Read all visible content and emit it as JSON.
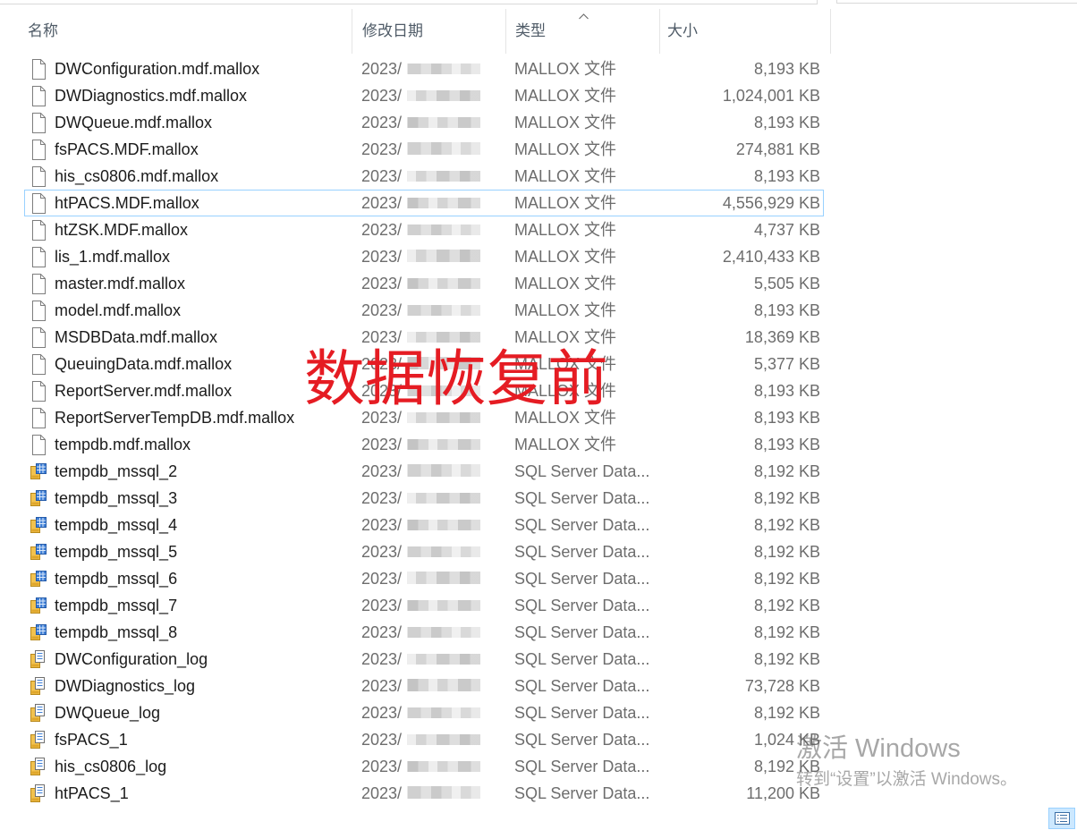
{
  "explorer": {
    "columns": {
      "name": {
        "label": "名称"
      },
      "date": {
        "label": "修改日期"
      },
      "type": {
        "label": "类型",
        "sort_icon": "chevron-up-icon"
      },
      "size": {
        "label": "大小"
      }
    },
    "view_button_icon": "details-view-icon"
  },
  "files": [
    {
      "name": "DWConfiguration.mdf.mallox",
      "date": "2023/",
      "type": "MALLOX 文件",
      "size": "8,193 KB",
      "icon": "blank-document-icon"
    },
    {
      "name": "DWDiagnostics.mdf.mallox",
      "date": "2023/",
      "type": "MALLOX 文件",
      "size": "1,024,001 KB",
      "icon": "blank-document-icon"
    },
    {
      "name": "DWQueue.mdf.mallox",
      "date": "2023/",
      "type": "MALLOX 文件",
      "size": "8,193 KB",
      "icon": "blank-document-icon"
    },
    {
      "name": "fsPACS.MDF.mallox",
      "date": "2023/",
      "type": "MALLOX 文件",
      "size": "274,881 KB",
      "icon": "blank-document-icon"
    },
    {
      "name": "his_cs0806.mdf.mallox",
      "date": "2023/",
      "type": "MALLOX 文件",
      "size": "8,193 KB",
      "icon": "blank-document-icon"
    },
    {
      "name": "htPACS.MDF.mallox",
      "date": "2023/",
      "type": "MALLOX 文件",
      "size": "4,556,929 KB",
      "icon": "blank-document-icon",
      "focused": true
    },
    {
      "name": "htZSK.MDF.mallox",
      "date": "2023/",
      "type": "MALLOX 文件",
      "size": "4,737 KB",
      "icon": "blank-document-icon"
    },
    {
      "name": "lis_1.mdf.mallox",
      "date": "2023/",
      "type": "MALLOX 文件",
      "size": "2,410,433 KB",
      "icon": "blank-document-icon"
    },
    {
      "name": "master.mdf.mallox",
      "date": "2023/",
      "type": "MALLOX 文件",
      "size": "5,505 KB",
      "icon": "blank-document-icon"
    },
    {
      "name": "model.mdf.mallox",
      "date": "2023/",
      "type": "MALLOX 文件",
      "size": "8,193 KB",
      "icon": "blank-document-icon"
    },
    {
      "name": "MSDBData.mdf.mallox",
      "date": "2023/",
      "type": "MALLOX 文件",
      "size": "18,369 KB",
      "icon": "blank-document-icon"
    },
    {
      "name": "QueuingData.mdf.mallox",
      "date": "2023/",
      "type": "MALLOX 文件",
      "size": "5,377 KB",
      "icon": "blank-document-icon"
    },
    {
      "name": "ReportServer.mdf.mallox",
      "date": "2023/",
      "type": "MALLOX 文件",
      "size": "8,193 KB",
      "icon": "blank-document-icon"
    },
    {
      "name": "ReportServerTempDB.mdf.mallox",
      "date": "2023/",
      "type": "MALLOX 文件",
      "size": "8,193 KB",
      "icon": "blank-document-icon"
    },
    {
      "name": "tempdb.mdf.mallox",
      "date": "2023/",
      "type": "MALLOX 文件",
      "size": "8,193 KB",
      "icon": "blank-document-icon"
    },
    {
      "name": "tempdb_mssql_2",
      "date": "2023/",
      "type": "SQL Server Data...",
      "size": "8,192 KB",
      "icon": "sql-data-file-icon"
    },
    {
      "name": "tempdb_mssql_3",
      "date": "2023/",
      "type": "SQL Server Data...",
      "size": "8,192 KB",
      "icon": "sql-data-file-icon"
    },
    {
      "name": "tempdb_mssql_4",
      "date": "2023/",
      "type": "SQL Server Data...",
      "size": "8,192 KB",
      "icon": "sql-data-file-icon"
    },
    {
      "name": "tempdb_mssql_5",
      "date": "2023/",
      "type": "SQL Server Data...",
      "size": "8,192 KB",
      "icon": "sql-data-file-icon"
    },
    {
      "name": "tempdb_mssql_6",
      "date": "2023/",
      "type": "SQL Server Data...",
      "size": "8,192 KB",
      "icon": "sql-data-file-icon"
    },
    {
      "name": "tempdb_mssql_7",
      "date": "2023/",
      "type": "SQL Server Data...",
      "size": "8,192 KB",
      "icon": "sql-data-file-icon"
    },
    {
      "name": "tempdb_mssql_8",
      "date": "2023/",
      "type": "SQL Server Data...",
      "size": "8,192 KB",
      "icon": "sql-data-file-icon"
    },
    {
      "name": "DWConfiguration_log",
      "date": "2023/",
      "type": "SQL Server Data...",
      "size": "8,192 KB",
      "icon": "sql-log-file-icon"
    },
    {
      "name": "DWDiagnostics_log",
      "date": "2023/",
      "type": "SQL Server Data...",
      "size": "73,728 KB",
      "icon": "sql-log-file-icon"
    },
    {
      "name": "DWQueue_log",
      "date": "2023/",
      "type": "SQL Server Data...",
      "size": "8,192 KB",
      "icon": "sql-log-file-icon"
    },
    {
      "name": "fsPACS_1",
      "date": "2023/",
      "type": "SQL Server Data...",
      "size": "1,024 KB",
      "icon": "sql-log-file-icon"
    },
    {
      "name": "his_cs0806_log",
      "date": "2023/",
      "type": "SQL Server Data...",
      "size": "8,192 KB",
      "icon": "sql-log-file-icon"
    },
    {
      "name": "htPACS_1",
      "date": "2023/",
      "type": "SQL Server Data...",
      "size": "11,200 KB",
      "icon": "sql-log-file-icon"
    }
  ],
  "overlay": {
    "text": "数据恢复前",
    "color": "#e51c23"
  },
  "activation_watermark": {
    "title": "激活 Windows",
    "subtitle": "转到“设置”以激活 Windows。"
  },
  "colors": {
    "focus_border": "#99d1ff",
    "primary_text": "#1b1b1b",
    "secondary_text": "#6d6d6d"
  }
}
